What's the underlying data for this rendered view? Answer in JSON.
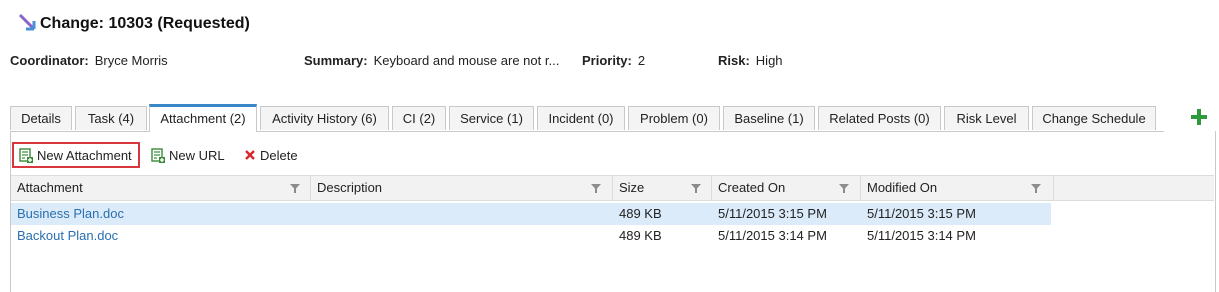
{
  "header": {
    "title": "Change: 10303 (Requested)",
    "icon": "change-request-icon"
  },
  "meta": {
    "coordinator_label": "Coordinator:",
    "coordinator_value": "Bryce Morris",
    "summary_label": "Summary:",
    "summary_value": "Keyboard and mouse are not r...",
    "priority_label": "Priority:",
    "priority_value": "2",
    "risk_label": "Risk:",
    "risk_value": "High"
  },
  "tabs": [
    {
      "label": "Details",
      "active": false
    },
    {
      "label": "Task (4)",
      "active": false
    },
    {
      "label": "Attachment (2)",
      "active": true
    },
    {
      "label": "Activity History (6)",
      "active": false
    },
    {
      "label": "CI (2)",
      "active": false
    },
    {
      "label": "Service (1)",
      "active": false
    },
    {
      "label": "Incident (0)",
      "active": false
    },
    {
      "label": "Problem (0)",
      "active": false
    },
    {
      "label": "Baseline (1)",
      "active": false
    },
    {
      "label": "Related Posts (0)",
      "active": false
    },
    {
      "label": "Risk Level",
      "active": false
    },
    {
      "label": "Change Schedule",
      "active": false
    }
  ],
  "toolbar": {
    "new_attachment": "New Attachment",
    "new_url": "New URL",
    "delete": "Delete"
  },
  "grid": {
    "columns": [
      "Attachment",
      "Description",
      "Size",
      "Created On",
      "Modified On"
    ],
    "rows": [
      {
        "attachment": "Business Plan.doc",
        "description": "",
        "size": "489 KB",
        "created": "5/11/2015 3:15 PM",
        "modified": "5/11/2015 3:15 PM",
        "selected": true
      },
      {
        "attachment": "Backout Plan.doc",
        "description": "",
        "size": "489 KB",
        "created": "5/11/2015 3:14 PM",
        "modified": "5/11/2015 3:14 PM",
        "selected": false
      }
    ]
  },
  "colors": {
    "accent_blue": "#3a87c8",
    "link_blue": "#2a6fb0",
    "highlight_red": "#d9363e",
    "add_green": "#2e9a3a",
    "selected_row": "#dcebf9"
  }
}
